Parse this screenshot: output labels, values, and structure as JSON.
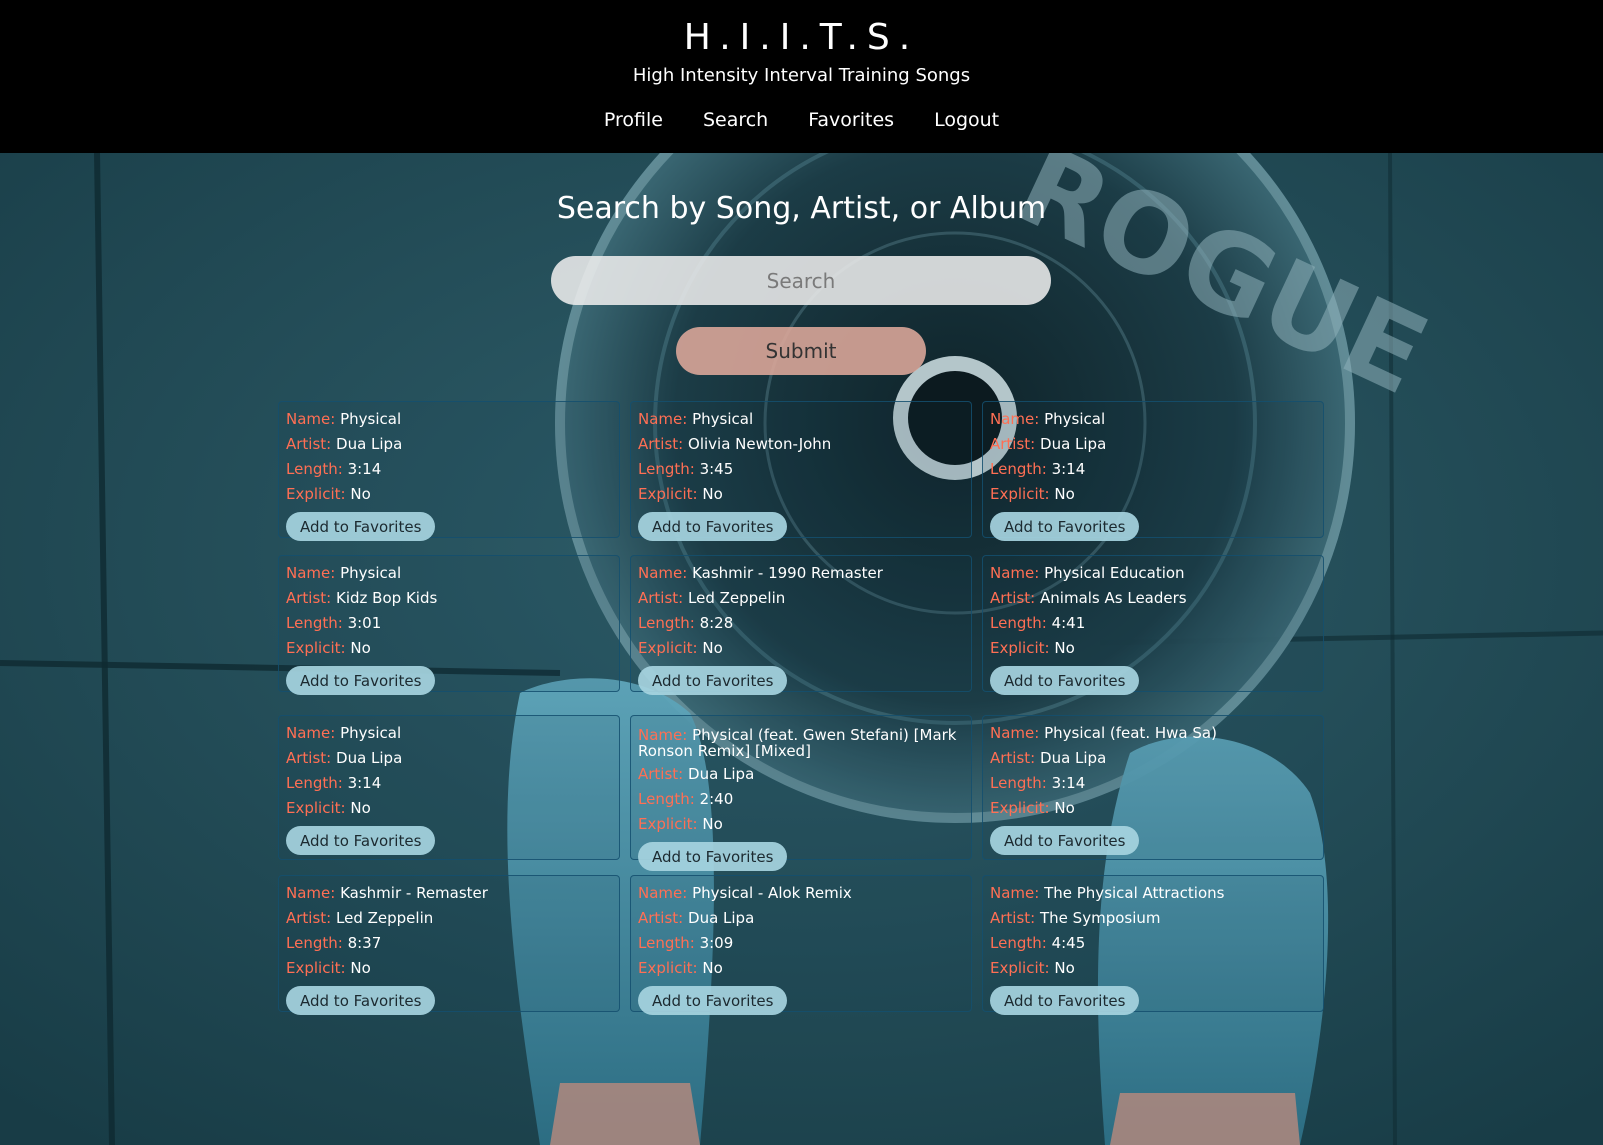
{
  "header": {
    "title": "H.I.I.T.S.",
    "subtitle": "High Intensity Interval Training Songs",
    "nav": [
      "Profile",
      "Search",
      "Favorites",
      "Logout"
    ]
  },
  "search": {
    "heading": "Search by Song, Artist, or Album",
    "placeholder": "Search",
    "submit_label": "Submit"
  },
  "labels": {
    "name": "Name:",
    "artist": "Artist:",
    "length": "Length:",
    "explicit": "Explicit:",
    "add_button": "Add to Favorites"
  },
  "results": [
    {
      "name": "Physical",
      "artist": "Dua Lipa",
      "length": "3:14",
      "explicit": "No"
    },
    {
      "name": "Physical",
      "artist": "Olivia Newton-John",
      "length": "3:45",
      "explicit": "No"
    },
    {
      "name": "Physical",
      "artist": "Dua Lipa",
      "length": "3:14",
      "explicit": "No"
    },
    {
      "name": "Physical",
      "artist": "Kidz Bop Kids",
      "length": "3:01",
      "explicit": "No"
    },
    {
      "name": "Kashmir - 1990 Remaster",
      "artist": "Led Zeppelin",
      "length": "8:28",
      "explicit": "No"
    },
    {
      "name": "Physical Education",
      "artist": "Animals As Leaders",
      "length": "4:41",
      "explicit": "No"
    },
    {
      "name": "Physical",
      "artist": "Dua Lipa",
      "length": "3:14",
      "explicit": "No"
    },
    {
      "name": "Physical (feat. Gwen Stefani) [Mark Ronson Remix] [Mixed]",
      "artist": "Dua Lipa",
      "length": "2:40",
      "explicit": "No"
    },
    {
      "name": "Physical (feat. Hwa Sa)",
      "artist": "Dua Lipa",
      "length": "3:14",
      "explicit": "No"
    },
    {
      "name": "Kashmir - Remaster",
      "artist": "Led Zeppelin",
      "length": "8:37",
      "explicit": "No"
    },
    {
      "name": "Physical - Alok Remix",
      "artist": "Dua Lipa",
      "length": "3:09",
      "explicit": "No"
    },
    {
      "name": "The Physical Attractions",
      "artist": "The Symposium",
      "length": "4:45",
      "explicit": "No"
    }
  ],
  "colors": {
    "header_bg": "#000000",
    "label_accent": "#ff6f54",
    "submit_bg": "#dea89b",
    "favorite_button_bg": "#a6d4df"
  },
  "background_image": {
    "lettering": "ROGUE"
  }
}
